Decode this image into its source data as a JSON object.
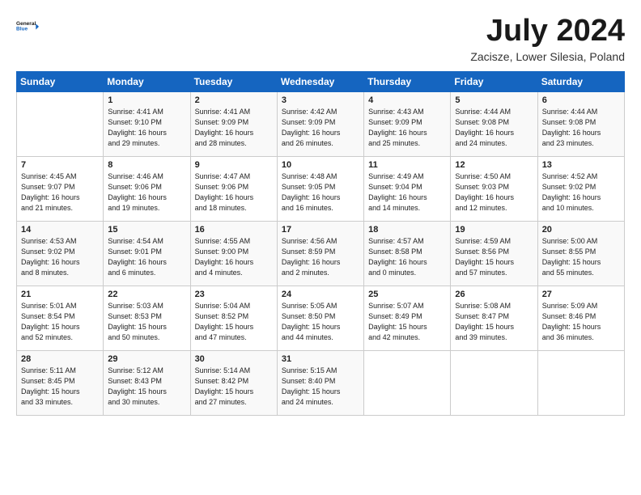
{
  "header": {
    "logo_line1": "General",
    "logo_line2": "Blue",
    "month": "July 2024",
    "location": "Zacisze, Lower Silesia, Poland"
  },
  "weekdays": [
    "Sunday",
    "Monday",
    "Tuesday",
    "Wednesday",
    "Thursday",
    "Friday",
    "Saturday"
  ],
  "weeks": [
    [
      {
        "num": "",
        "info": ""
      },
      {
        "num": "1",
        "info": "Sunrise: 4:41 AM\nSunset: 9:10 PM\nDaylight: 16 hours\nand 29 minutes."
      },
      {
        "num": "2",
        "info": "Sunrise: 4:41 AM\nSunset: 9:09 PM\nDaylight: 16 hours\nand 28 minutes."
      },
      {
        "num": "3",
        "info": "Sunrise: 4:42 AM\nSunset: 9:09 PM\nDaylight: 16 hours\nand 26 minutes."
      },
      {
        "num": "4",
        "info": "Sunrise: 4:43 AM\nSunset: 9:09 PM\nDaylight: 16 hours\nand 25 minutes."
      },
      {
        "num": "5",
        "info": "Sunrise: 4:44 AM\nSunset: 9:08 PM\nDaylight: 16 hours\nand 24 minutes."
      },
      {
        "num": "6",
        "info": "Sunrise: 4:44 AM\nSunset: 9:08 PM\nDaylight: 16 hours\nand 23 minutes."
      }
    ],
    [
      {
        "num": "7",
        "info": "Sunrise: 4:45 AM\nSunset: 9:07 PM\nDaylight: 16 hours\nand 21 minutes."
      },
      {
        "num": "8",
        "info": "Sunrise: 4:46 AM\nSunset: 9:06 PM\nDaylight: 16 hours\nand 19 minutes."
      },
      {
        "num": "9",
        "info": "Sunrise: 4:47 AM\nSunset: 9:06 PM\nDaylight: 16 hours\nand 18 minutes."
      },
      {
        "num": "10",
        "info": "Sunrise: 4:48 AM\nSunset: 9:05 PM\nDaylight: 16 hours\nand 16 minutes."
      },
      {
        "num": "11",
        "info": "Sunrise: 4:49 AM\nSunset: 9:04 PM\nDaylight: 16 hours\nand 14 minutes."
      },
      {
        "num": "12",
        "info": "Sunrise: 4:50 AM\nSunset: 9:03 PM\nDaylight: 16 hours\nand 12 minutes."
      },
      {
        "num": "13",
        "info": "Sunrise: 4:52 AM\nSunset: 9:02 PM\nDaylight: 16 hours\nand 10 minutes."
      }
    ],
    [
      {
        "num": "14",
        "info": "Sunrise: 4:53 AM\nSunset: 9:02 PM\nDaylight: 16 hours\nand 8 minutes."
      },
      {
        "num": "15",
        "info": "Sunrise: 4:54 AM\nSunset: 9:01 PM\nDaylight: 16 hours\nand 6 minutes."
      },
      {
        "num": "16",
        "info": "Sunrise: 4:55 AM\nSunset: 9:00 PM\nDaylight: 16 hours\nand 4 minutes."
      },
      {
        "num": "17",
        "info": "Sunrise: 4:56 AM\nSunset: 8:59 PM\nDaylight: 16 hours\nand 2 minutes."
      },
      {
        "num": "18",
        "info": "Sunrise: 4:57 AM\nSunset: 8:58 PM\nDaylight: 16 hours\nand 0 minutes."
      },
      {
        "num": "19",
        "info": "Sunrise: 4:59 AM\nSunset: 8:56 PM\nDaylight: 15 hours\nand 57 minutes."
      },
      {
        "num": "20",
        "info": "Sunrise: 5:00 AM\nSunset: 8:55 PM\nDaylight: 15 hours\nand 55 minutes."
      }
    ],
    [
      {
        "num": "21",
        "info": "Sunrise: 5:01 AM\nSunset: 8:54 PM\nDaylight: 15 hours\nand 52 minutes."
      },
      {
        "num": "22",
        "info": "Sunrise: 5:03 AM\nSunset: 8:53 PM\nDaylight: 15 hours\nand 50 minutes."
      },
      {
        "num": "23",
        "info": "Sunrise: 5:04 AM\nSunset: 8:52 PM\nDaylight: 15 hours\nand 47 minutes."
      },
      {
        "num": "24",
        "info": "Sunrise: 5:05 AM\nSunset: 8:50 PM\nDaylight: 15 hours\nand 44 minutes."
      },
      {
        "num": "25",
        "info": "Sunrise: 5:07 AM\nSunset: 8:49 PM\nDaylight: 15 hours\nand 42 minutes."
      },
      {
        "num": "26",
        "info": "Sunrise: 5:08 AM\nSunset: 8:47 PM\nDaylight: 15 hours\nand 39 minutes."
      },
      {
        "num": "27",
        "info": "Sunrise: 5:09 AM\nSunset: 8:46 PM\nDaylight: 15 hours\nand 36 minutes."
      }
    ],
    [
      {
        "num": "28",
        "info": "Sunrise: 5:11 AM\nSunset: 8:45 PM\nDaylight: 15 hours\nand 33 minutes."
      },
      {
        "num": "29",
        "info": "Sunrise: 5:12 AM\nSunset: 8:43 PM\nDaylight: 15 hours\nand 30 minutes."
      },
      {
        "num": "30",
        "info": "Sunrise: 5:14 AM\nSunset: 8:42 PM\nDaylight: 15 hours\nand 27 minutes."
      },
      {
        "num": "31",
        "info": "Sunrise: 5:15 AM\nSunset: 8:40 PM\nDaylight: 15 hours\nand 24 minutes."
      },
      {
        "num": "",
        "info": ""
      },
      {
        "num": "",
        "info": ""
      },
      {
        "num": "",
        "info": ""
      }
    ]
  ]
}
